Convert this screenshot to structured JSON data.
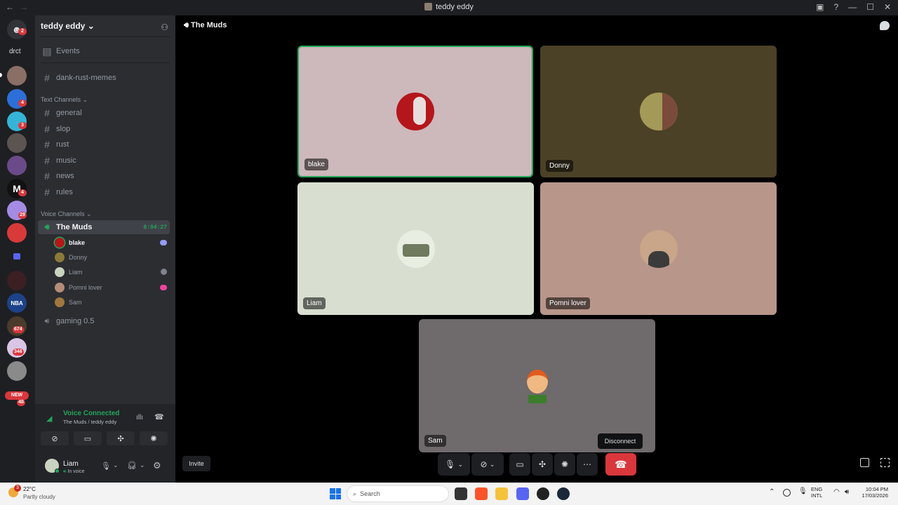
{
  "window": {
    "title": "teddy eddy",
    "back": "←",
    "forward": "→",
    "minimize": "—",
    "maximize": "☐",
    "close": "✕"
  },
  "guilds": {
    "dm_badge": "2",
    "folder_label": "drct",
    "badges": [
      "4",
      "3",
      "4",
      "29",
      "674",
      "346",
      "48"
    ],
    "new_label": "NEW"
  },
  "sidebar": {
    "server_name": "teddy eddy",
    "events": "Events",
    "pinned_channel": "dank-rust-memes",
    "text_category": "Text Channels",
    "text_channels": [
      "general",
      "slop",
      "rust",
      "music",
      "news",
      "rules"
    ],
    "voice_category": "Voice Channels",
    "active_voice": {
      "name": "The Muds",
      "timer": "8:04:27"
    },
    "voice_users": [
      "blake",
      "Donny",
      "Liam",
      "Pomni lover",
      "Sam"
    ],
    "other_voice": "gaming 0.5"
  },
  "voice_panel": {
    "status": "Voice Connected",
    "location": "The Muds / teddy eddy",
    "user": "Liam",
    "user_status": "In voice"
  },
  "main": {
    "channel_title": "The Muds",
    "participants": [
      {
        "name": "blake",
        "bg": "#cdb8bb"
      },
      {
        "name": "Donny",
        "bg": "#4b4126"
      },
      {
        "name": "Liam",
        "bg": "#d8dfd0"
      },
      {
        "name": "Pomni lover",
        "bg": "#b8968a"
      },
      {
        "name": "Sam",
        "bg": "#6f6a6b"
      }
    ],
    "invite": "Invite",
    "disconnect_tooltip": "Disconnect"
  },
  "taskbar": {
    "weather_badge": "3",
    "temperature": "22°C",
    "conditions": "Partly cloudy",
    "search_placeholder": "Search",
    "lang1": "ENG",
    "lang2": "INTL",
    "time": "10:04 PM",
    "date": "17/03/2026"
  },
  "colors": {
    "accent_green": "#23a55a",
    "danger": "#da373c",
    "blurple": "#5865f2"
  }
}
